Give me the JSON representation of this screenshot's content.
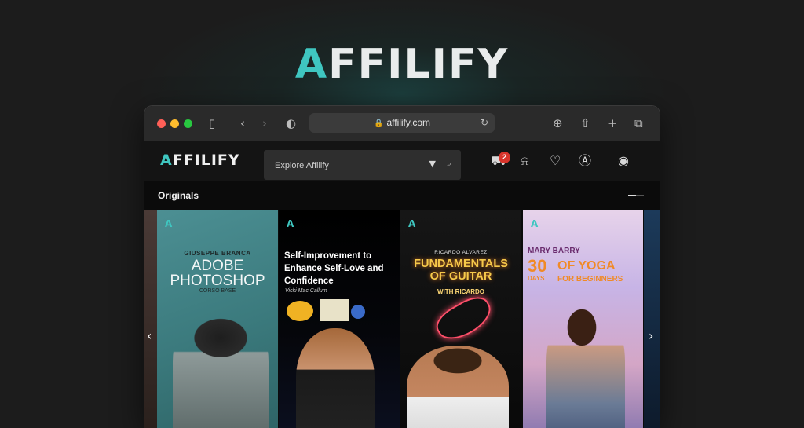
{
  "hero": {
    "brand_mark": "A",
    "brand_rest": "FFILIFY"
  },
  "browser": {
    "url": "affilify.com",
    "icons": {
      "sidebar": "sidebar-icon",
      "back": "back-icon",
      "forward": "forward-icon",
      "shield": "shield-icon",
      "lock": "lock-icon",
      "reload": "reload-icon",
      "download": "download-icon",
      "share": "share-icon",
      "new_tab": "plus-icon",
      "tabs": "tabs-icon"
    }
  },
  "site": {
    "logo_mark": "A",
    "logo_rest": "FFILIFY",
    "search": {
      "placeholder": "Explore Affilify"
    },
    "cart_count": "2",
    "section_title": "Originals"
  },
  "cards": [
    {
      "brand": "A",
      "eyebrow": "GIUSEPPE BRANCA",
      "title_line1": "ADOBE",
      "title_line2": "PHOTOSHOP",
      "subtitle": "CORSO BASE"
    },
    {
      "brand": "A",
      "title": "Self-Improvement to Enhance Self-Love and Confidence",
      "author": "Vicki Mac Callum"
    },
    {
      "brand": "A",
      "eyebrow": "RICARDO ALVAREZ",
      "title_line1": "FUNDAMENTALS",
      "title_line2": "OF GUITAR",
      "subtitle": "WITH RICARDO"
    },
    {
      "brand": "A",
      "eyebrow": "MARY BARRY",
      "number": "30",
      "days": "DAYS",
      "title": "OF YOGA",
      "subtitle": "FOR BEGINNERS"
    }
  ],
  "colors": {
    "accent": "#3fc6c0",
    "badge": "#d9342b",
    "background": "#1c1c1c"
  }
}
